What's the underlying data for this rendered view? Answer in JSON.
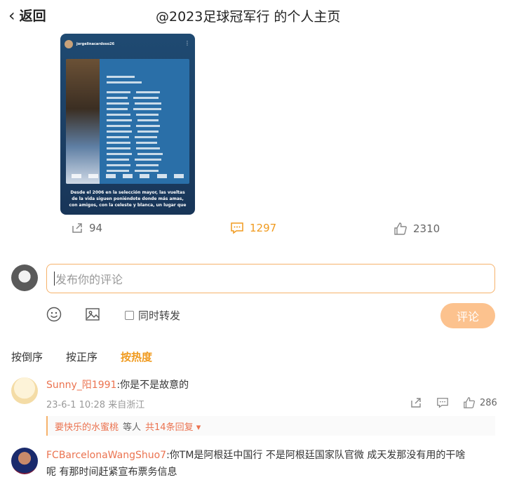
{
  "nav": {
    "back_label": "返回",
    "title": "@2023足球冠军行 的个人主页"
  },
  "post": {
    "image_username": "jorgelinacardoso26",
    "image_caption": "Desde el 2006 en la selección mayor, las vueltas de la vida siguen poniéndote donde más amas, con amigos, con la celeste y blanca, un lugar que",
    "reposts": "94",
    "comments": "1297",
    "likes": "2310"
  },
  "composer": {
    "placeholder": "发布你的评论",
    "repost_label": "同时转发",
    "submit_label": "评论"
  },
  "sort": {
    "desc": "按倒序",
    "asc": "按正序",
    "hot": "按热度"
  },
  "comments": [
    {
      "user": "Sunny_阳1991",
      "text": ":你是不是故意的",
      "meta": "23-6-1 10:28 来自浙江",
      "likes": "286",
      "reply_user": "要快乐的水蜜桃",
      "reply_mid": "等人",
      "reply_count": "共14条回复 ▾"
    },
    {
      "user": "FCBarcelonaWangShuo7",
      "text": ":你TM是阿根廷中国行 不是阿根廷国家队官微 成天发那没有用的干啥",
      "text2": "呢 有那时间赶紧宣布票务信息"
    }
  ],
  "colors": {
    "accent": "#f09a1e",
    "username": "#eb7350",
    "input_border": "#f6b26b",
    "submit_bg": "#fcc28e"
  }
}
